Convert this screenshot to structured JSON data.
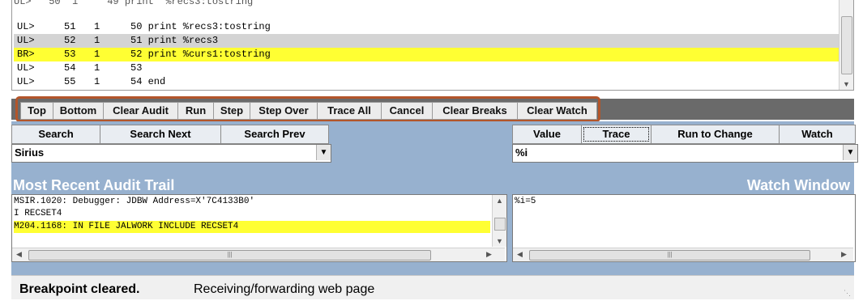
{
  "code": {
    "partial_line": "UL>   50  1     49 print '%recs3:tostring'",
    "rows": [
      {
        "tag": "UL>",
        "num": "51",
        "lvl": "1",
        "text": "50 print %recs3:tostring",
        "hl": "none"
      },
      {
        "tag": "UL>",
        "num": "52",
        "lvl": "1",
        "text": "51 print %recs3",
        "hl": "gray"
      },
      {
        "tag": "BR>",
        "num": "53",
        "lvl": "1",
        "text": "52 print %curs1:tostring",
        "hl": "yellow"
      },
      {
        "tag": "UL>",
        "num": "54",
        "lvl": "1",
        "text": "53",
        "hl": "none"
      },
      {
        "tag": "UL>",
        "num": "55",
        "lvl": "1",
        "text": "54 end",
        "hl": "none"
      }
    ]
  },
  "toolbar": {
    "top": "Top",
    "bottom": "Bottom",
    "clear_audit": "Clear Audit",
    "run": "Run",
    "step": "Step",
    "step_over": "Step Over",
    "trace_all": "Trace All",
    "cancel": "Cancel",
    "clear_breaks": "Clear Breaks",
    "clear_watch": "Clear Watch"
  },
  "search": {
    "search": "Search",
    "search_next": "Search Next",
    "search_prev": "Search Prev",
    "value": "Sirius"
  },
  "watch_controls": {
    "value": "Value",
    "trace": "Trace",
    "run_to_change": "Run to Change",
    "watch": "Watch",
    "field_value": "%i"
  },
  "audit": {
    "title": "Most Recent Audit Trail",
    "lines": [
      {
        "text": "MSIR.1020: Debugger: JDBW Address=X'7C4133B0'",
        "hl": false
      },
      {
        "text": "I RECSET4",
        "hl": false
      },
      {
        "text": "M204.1168: IN FILE JALWORK INCLUDE RECSET4",
        "hl": true
      }
    ]
  },
  "watch_window": {
    "title": "Watch Window",
    "lines": [
      "%i=5"
    ]
  },
  "status": {
    "bold": "Breakpoint cleared.",
    "text": "Receiving/forwarding web page"
  },
  "colors": {
    "accent_outline": "#b3552a",
    "highlight_yellow": "#ffff33",
    "highlight_gray": "#d4d4d4",
    "panel_blue": "#97b1cf"
  }
}
